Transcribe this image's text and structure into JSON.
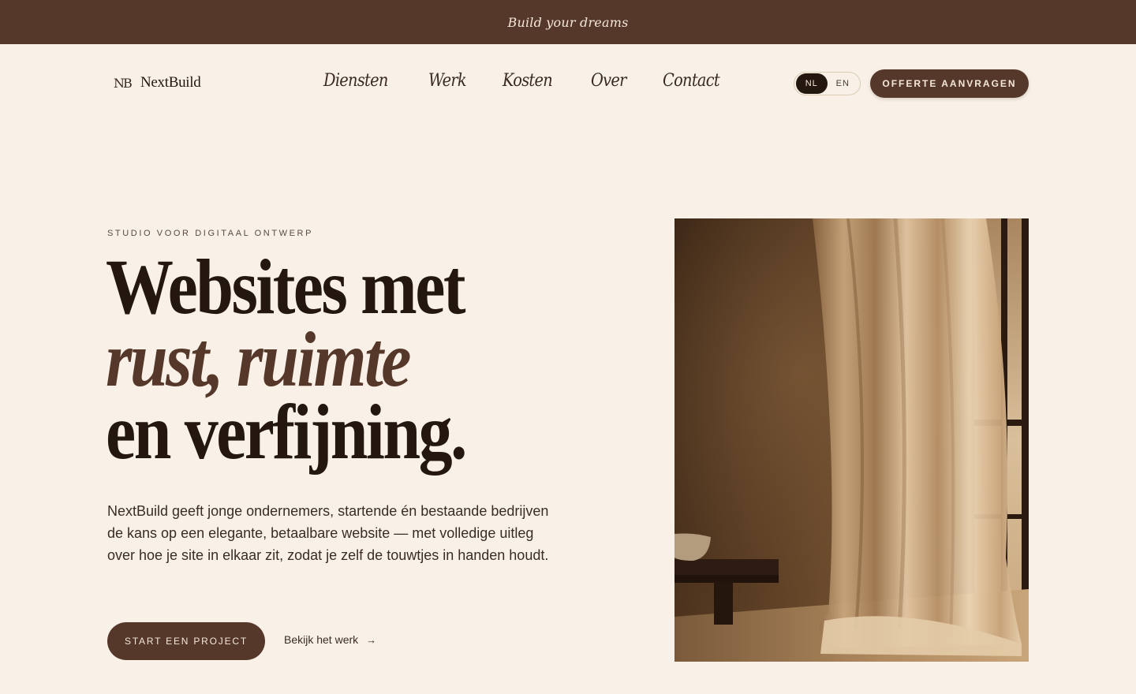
{
  "announcement": "Build your dreams",
  "brand": {
    "mark": "NB",
    "name": "NextBuild"
  },
  "nav": [
    "Diensten",
    "Werk",
    "Kosten",
    "Over",
    "Contact"
  ],
  "language": {
    "options": [
      "NL",
      "EN"
    ],
    "selected": "NL"
  },
  "header_cta": "OFFERTE AANVRAGEN",
  "hero": {
    "eyebrow": "STUDIO VOOR DIGITAAL ONTWERP",
    "headline": [
      "Websites met",
      "rust, ruimte",
      "en verfijning."
    ],
    "lead": "NextBuild geeft jonge ondernemers, startende én bestaande bedrijven de kans op een elegante, betaalbare website — met volledige uitleg over hoe je site in elkaar zit, zodat je zelf de touwtjes in handen houdt.",
    "primary_cta": "START EEN PROJECT",
    "secondary_cta": "Bekijk het werk",
    "secondary_arrow": "→"
  },
  "colors": {
    "background": "#f9f1e7",
    "brand_brown": "#55382a",
    "ink": "#24170f"
  }
}
